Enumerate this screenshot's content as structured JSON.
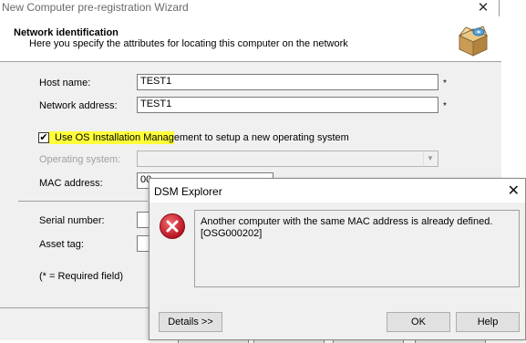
{
  "wizard": {
    "title": "New Computer pre-registration Wizard",
    "close_glyph": "✕",
    "header_title": "Network identification",
    "header_subtitle": "Here you specify the attributes for locating this computer on the network",
    "icon": "package-box-icon"
  },
  "form": {
    "host_name_label": "Host name:",
    "host_name_value": "TEST1",
    "network_address_label": "Network address:",
    "network_address_value": "TEST1",
    "required_marker": "*",
    "os_checkbox_checked": true,
    "os_checkbox_label": "Use OS Installation Management to setup a new operating system",
    "operating_system_label": "Operating system:",
    "mac_address_label": "MAC address:",
    "mac_address_value": "00",
    "serial_number_label": "Serial number:",
    "asset_tag_label": "Asset tag:",
    "required_note": "(* = Required field)"
  },
  "dialog": {
    "title": "DSM Explorer",
    "close_glyph": "✕",
    "icon": "error-icon",
    "message_line1": "Another computer with the same MAC address is already defined.",
    "message_line2": "[OSG000202]",
    "details_label": "Details >>",
    "ok_label": "OK",
    "help_label": "Help"
  },
  "colors": {
    "highlight": "#ffff3a",
    "error_red": "#c8102e"
  }
}
